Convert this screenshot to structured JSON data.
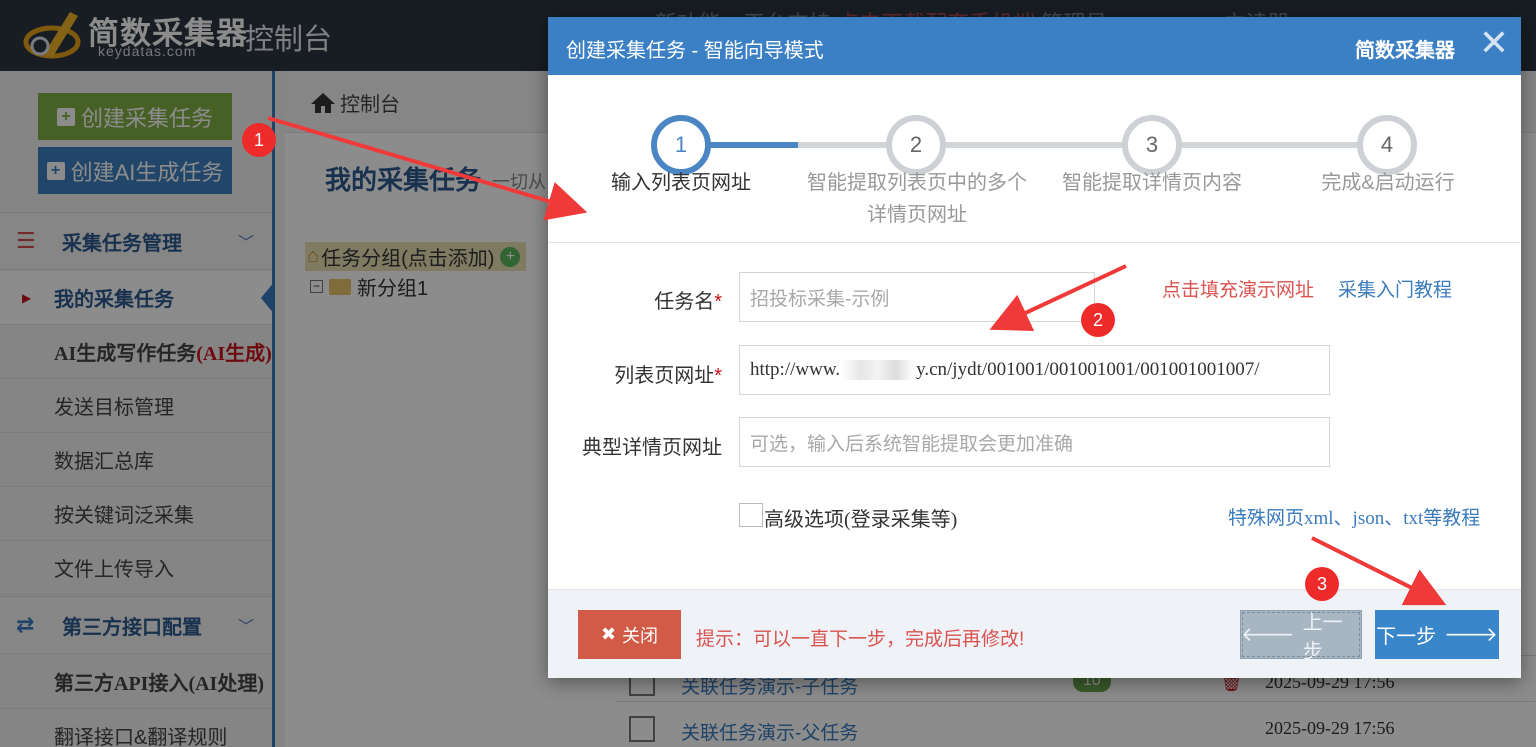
{
  "header": {
    "logo_text": "简数采集器",
    "logo_domain": "keydatas.com",
    "console_label": "控制台",
    "faded_text_1": "新功能：平台支持",
    "faded_text_red": "点击下载配套手机端",
    "faded_text_2": "管理员",
    "faded_text_3": "立读器"
  },
  "sidebar": {
    "create_task_label": "创建采集任务",
    "create_ai_task_label": "创建AI生成任务",
    "section1_title": "采集任务管理",
    "items": [
      {
        "label": "我的采集任务"
      },
      {
        "label": "AI生成写作任务",
        "tag": "(AI生成)"
      },
      {
        "label": "发送目标管理"
      },
      {
        "label": "数据汇总库"
      },
      {
        "label": "按关键词泛采集"
      },
      {
        "label": "文件上传导入"
      }
    ],
    "section2_title": "第三方接口配置",
    "items2": [
      {
        "label": "第三方API接入(AI处理)"
      },
      {
        "label": "翻译接口&翻译规则"
      }
    ]
  },
  "main": {
    "breadcrumb": "控制台",
    "page_title": "我的采集任务",
    "page_subtitle": "一切从",
    "tree_group_label": "任务分组(点击添加)",
    "tree_child_label": "新分组1",
    "peek_row1": "关联任务演示-子任务",
    "peek_row1_count": "10",
    "peek_row1_date": "2025-09-29 17:56",
    "peek_row2": "关联任务演示-父任务",
    "peek_row2_date": "2025-09-29 17:56"
  },
  "modal": {
    "title": "创建采集任务 - 智能向导模式",
    "brand": "简数采集器",
    "close_glyph": "✕",
    "steps": [
      {
        "num": "1",
        "label": "输入列表页网址"
      },
      {
        "num": "2",
        "label": "智能提取列表页中的多个详情页网址"
      },
      {
        "num": "3",
        "label": "智能提取详情页内容"
      },
      {
        "num": "4",
        "label": "完成&启动运行"
      }
    ],
    "current_step": 1,
    "task_name_label": "任务名",
    "task_name_placeholder": "招投标采集-示例",
    "list_url_label": "列表页网址",
    "list_url_prefix": "http://www.",
    "list_url_suffix": "y.cn/jydt/001001/001001001/001001001007/",
    "detail_url_label": "典型详情页网址",
    "detail_url_placeholder": "可选，输入后系统智能提取会更加准确",
    "fill_demo_link": "点击填充演示网址",
    "tutorial_link": "采集入门教程",
    "advanced_label": "高级选项(登录采集等)",
    "special_link": "特殊网页xml、json、txt等教程",
    "close_button": "关闭",
    "hint": "提示：可以一直下一步，完成后再修改!",
    "prev_button": "上一步",
    "next_button": "下一步"
  },
  "annotations": {
    "badge1": "1",
    "badge2": "2",
    "badge3": "3",
    "arrow_color": "#f03a3a"
  }
}
